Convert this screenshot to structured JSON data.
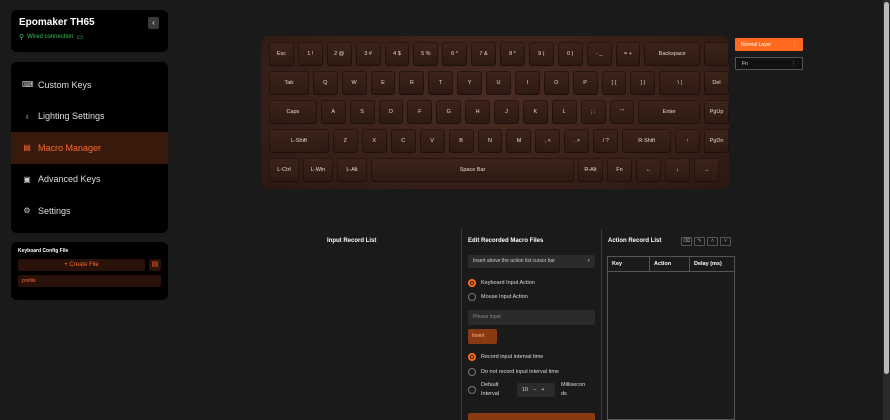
{
  "device": {
    "name": "Epomaker TH65",
    "connection": "Wired connection"
  },
  "nav": {
    "items": [
      {
        "label": "Custom Keys",
        "icon": "keyboard-icon",
        "glyph": "⌨"
      },
      {
        "label": "Lighting Settings",
        "icon": "bulb-icon",
        "glyph": "♁"
      },
      {
        "label": "Macro Manager",
        "icon": "macro-icon",
        "glyph": "▤"
      },
      {
        "label": "Advanced Keys",
        "icon": "advanced-keys-icon",
        "glyph": "▣"
      },
      {
        "label": "Settings",
        "icon": "gear-icon",
        "glyph": "⚙"
      }
    ],
    "active_index": 2
  },
  "config": {
    "title": "Keyboard Config File",
    "create_label": "+ Create File",
    "profile": "profile"
  },
  "keyboard": {
    "rows": [
      [
        [
          "Esc",
          25
        ],
        [
          "1 !",
          25
        ],
        [
          "2 @",
          25
        ],
        [
          "3 #",
          25
        ],
        [
          "4 $",
          25
        ],
        [
          "5 %",
          25
        ],
        [
          "6 ^",
          25
        ],
        [
          "7 &",
          25
        ],
        [
          "8 *",
          25
        ],
        [
          "9 (",
          25
        ],
        [
          "0 )",
          25
        ],
        [
          "- _",
          25
        ],
        [
          "= +",
          25
        ],
        [
          "Backspace",
          56
        ],
        [
          "",
          25
        ]
      ],
      [
        [
          "Tab",
          40
        ],
        [
          "Q",
          25
        ],
        [
          "W",
          25
        ],
        [
          "E",
          25
        ],
        [
          "R",
          25
        ],
        [
          "T",
          25
        ],
        [
          "Y",
          25
        ],
        [
          "U",
          25
        ],
        [
          "I",
          25
        ],
        [
          "O",
          25
        ],
        [
          "P",
          25
        ],
        [
          "[ {",
          25
        ],
        [
          "] }",
          25
        ],
        [
          "\\ |",
          41
        ],
        [
          "Del",
          25
        ]
      ],
      [
        [
          "Caps",
          48
        ],
        [
          "A",
          25
        ],
        [
          "S",
          25
        ],
        [
          "D",
          25
        ],
        [
          "F",
          25
        ],
        [
          "G",
          25
        ],
        [
          "H",
          25
        ],
        [
          "J",
          25
        ],
        [
          "K",
          25
        ],
        [
          "L",
          25
        ],
        [
          "; :",
          25
        ],
        [
          "' \"",
          25
        ],
        [
          "Enter",
          62
        ],
        [
          "PgUp",
          25
        ]
      ],
      [
        [
          "L-Shift",
          60
        ],
        [
          "Z",
          25
        ],
        [
          "X",
          25
        ],
        [
          "C",
          25
        ],
        [
          "V",
          25
        ],
        [
          "B",
          25
        ],
        [
          "N",
          25
        ],
        [
          "M",
          25
        ],
        [
          ", <",
          25
        ],
        [
          ". >",
          25
        ],
        [
          "/ ?",
          25
        ],
        [
          "R-Shift",
          49
        ],
        [
          "↑",
          25
        ],
        [
          "PgDn",
          25
        ]
      ],
      [
        [
          "L-Ctrl",
          30
        ],
        [
          "L-Win",
          30
        ],
        [
          "L-Alt",
          30
        ],
        [
          "Space Bar",
          203
        ],
        [
          "R-Alt",
          25
        ],
        [
          "Fn",
          25
        ],
        [
          "←",
          25
        ],
        [
          "↓",
          25
        ],
        [
          "→",
          25
        ]
      ]
    ]
  },
  "layers": [
    {
      "label": "Normal Layer",
      "menu": "⋮"
    },
    {
      "label": "Fn",
      "menu": "⋮"
    }
  ],
  "macro": {
    "input_record_title": "Input Record List",
    "edit_title": "Edit Recorded Macro Files",
    "insert_position": "Insert above the action list cursor bar",
    "keyboard_action": "Keyboard Input Action",
    "mouse_action": "Mouse Input Action",
    "input_placeholder": "Please Input",
    "insert_label": "Insert",
    "record_interval": "Record input interval time",
    "no_record_interval": "Do not record input interval time",
    "default_interval_line1": "Default",
    "default_interval_line2": "Interval",
    "interval_value": "10",
    "ms_line1": "Millisecon",
    "ms_line2": "ds",
    "action_record_title": "Action Record List",
    "columns": [
      "Key",
      "Action",
      "Delay (ms)"
    ]
  },
  "colors": {
    "accent": "#ff6a1f",
    "connection": "#37c45b"
  }
}
